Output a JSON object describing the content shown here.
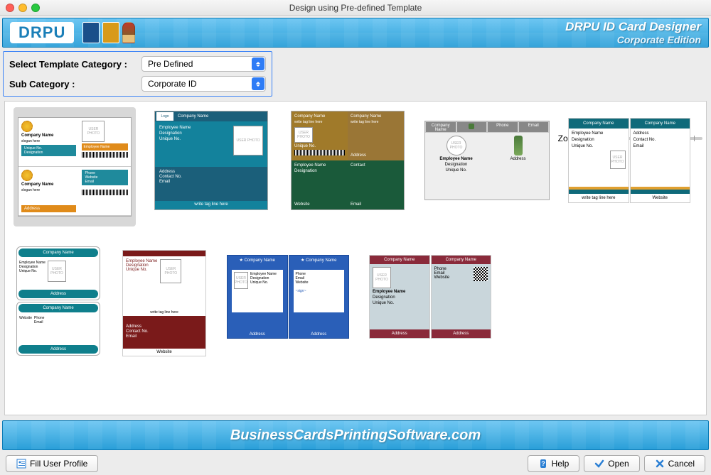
{
  "window": {
    "title": "Design using Pre-defined Template"
  },
  "banner": {
    "logo": "DRPU",
    "title": "DRPU ID Card Designer",
    "subtitle": "Corporate Edition"
  },
  "selectors": {
    "category_label": "Select Template Category :",
    "category_value": "Pre Defined",
    "subcategory_label": "Sub Category :",
    "subcategory_value": "Corporate ID",
    "zoom_label": "Zoom In/Out :"
  },
  "placeholders": {
    "company_name": "Company Name",
    "slogan": "slogan here",
    "employee_name": "Employee Name",
    "unique_no": "Unique No.",
    "designation": "Designation",
    "contact_no": "Contact No.",
    "phone": "Phone",
    "website": "Website",
    "email": "Email",
    "address": "Address",
    "user_photo": "USER PHOTO",
    "logo": "Logo",
    "tagline": "write tag line here",
    "contact": "Contact"
  },
  "footer": {
    "url": "BusinessCardsPrintingSoftware.com"
  },
  "buttons": {
    "fill_profile": "Fill User Profile",
    "help": "Help",
    "open": "Open",
    "cancel": "Cancel"
  }
}
